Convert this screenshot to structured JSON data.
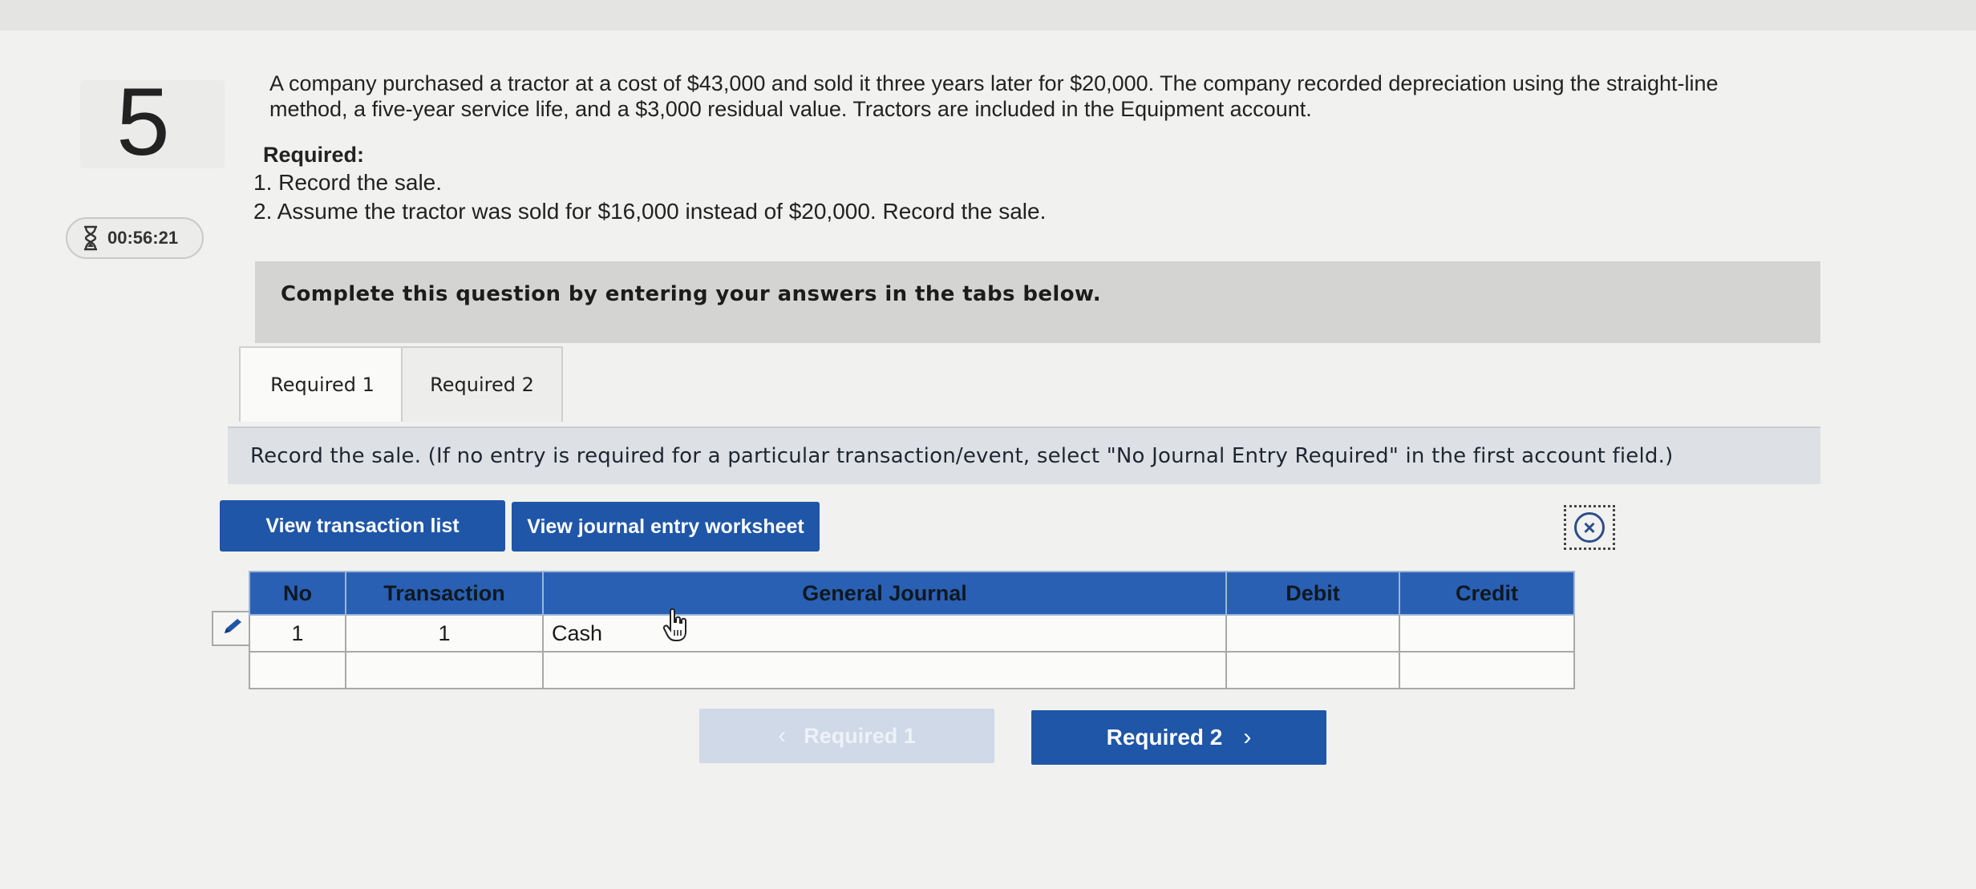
{
  "question": {
    "number": "5",
    "timer": "00:56:21",
    "prompt": "A company purchased a tractor at a cost of $43,000 and sold it three years later for $20,000. The company recorded depreciation using the straight-line method, a five-year service life, and a $3,000 residual value. Tractors are included in the Equipment account.",
    "required_heading": "Required:",
    "required_items": [
      "1. Record the sale.",
      "2. Assume the tractor was sold for $16,000 instead of $20,000. Record the sale."
    ]
  },
  "instruction_banner": "Complete this question by entering your answers in the tabs below.",
  "tabs": [
    {
      "label": "Required 1",
      "active": true
    },
    {
      "label": "Required 2",
      "active": false
    }
  ],
  "panel": {
    "instructions": "Record the sale. (If no entry is required for a particular transaction/event, select \"No Journal Entry Required\" in the first account field.)"
  },
  "buttons": {
    "view_transaction_list": "View transaction list",
    "view_journal_worksheet": "View journal entry worksheet"
  },
  "journal": {
    "columns": {
      "no": "No",
      "transaction": "Transaction",
      "general_journal": "General Journal",
      "debit": "Debit",
      "credit": "Credit"
    },
    "rows": [
      {
        "no": "1",
        "transaction": "1",
        "account": "Cash",
        "debit": "",
        "credit": ""
      },
      {
        "no": "",
        "transaction": "",
        "account": "",
        "debit": "",
        "credit": ""
      }
    ]
  },
  "navigation": {
    "prev_label": "Required 1",
    "next_label": "Required 2"
  },
  "colors": {
    "accent_blue": "#1f56a8",
    "table_header": "#2960b4",
    "disabled_button": "#cfd9e7"
  },
  "icons": [
    "hourglass-icon",
    "close-icon",
    "pencil-icon",
    "hand-cursor-icon",
    "chevron-left-icon",
    "chevron-right-icon"
  ]
}
